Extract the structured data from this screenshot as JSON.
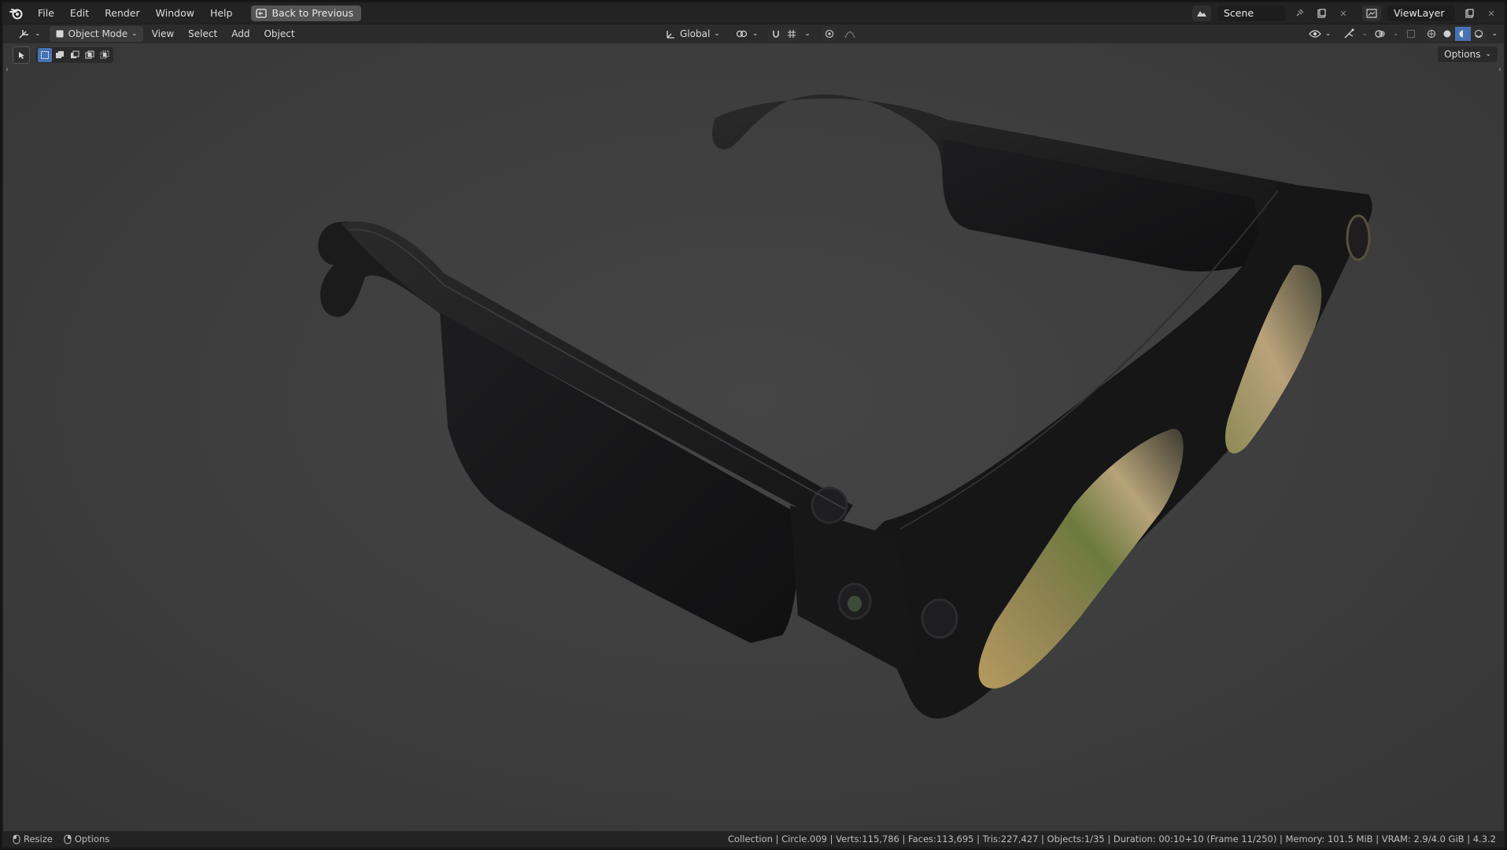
{
  "topbar": {
    "menus": [
      "File",
      "Edit",
      "Render",
      "Window",
      "Help"
    ],
    "back_button": "Back to Previous",
    "scene_name": "Scene",
    "view_layer_name": "ViewLayer"
  },
  "header": {
    "mode": "Object Mode",
    "menus": [
      "View",
      "Select",
      "Add",
      "Object"
    ],
    "orientation": "Global"
  },
  "viewport": {
    "options_label": "Options",
    "object": "smart glasses with camera modules and tinted lenses"
  },
  "statusbar": {
    "left_items": [
      "Resize",
      "Options"
    ],
    "info": "Collection | Circle.009 | Verts:115,786 | Faces:113,695 | Tris:227,427 | Objects:1/35 | Duration: 00:10+10 (Frame 11/250) | Memory: 101.5 MiB | VRAM: 2.9/4.0 GiB | 4.3.2"
  },
  "colors": {
    "accent": "#4772b3",
    "viewport_bg": "#3d3d3d",
    "topbar_bg": "#232323",
    "header_bg": "#2b2b2b"
  }
}
